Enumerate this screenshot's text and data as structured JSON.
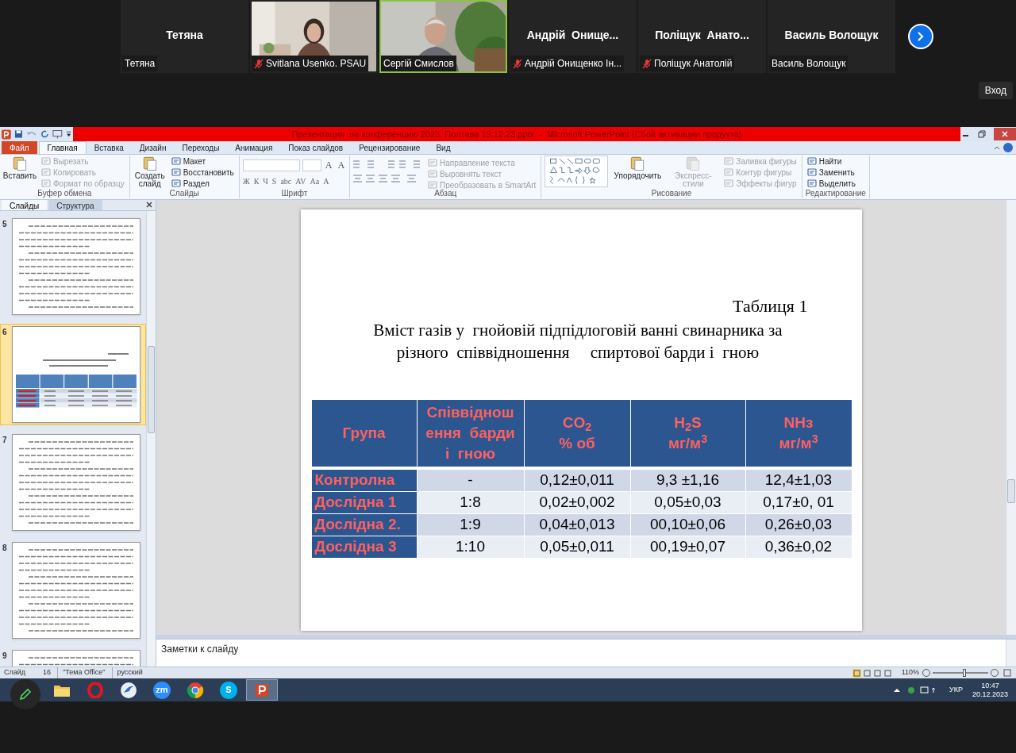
{
  "participants": [
    {
      "kind": "name",
      "display": "Тетяна",
      "label": "Тетяна",
      "muted": false,
      "selected": false
    },
    {
      "kind": "video",
      "label": "Svitlana Usenko. PSAU",
      "muted": true,
      "selected": false
    },
    {
      "kind": "video",
      "label": "Сергій Смислов",
      "muted": false,
      "selected": true
    },
    {
      "kind": "name",
      "display": "Андрій  Онище...",
      "label": "Андрій Онищенко Ін...",
      "muted": true,
      "selected": false
    },
    {
      "kind": "name",
      "display": "Поліщук  Анато...",
      "label": "Поліщук Анатолій",
      "muted": true,
      "selected": false
    },
    {
      "kind": "name",
      "display": "Василь Волощук",
      "label": "Василь Волощук",
      "muted": false,
      "selected": false
    }
  ],
  "sign_in_button": "Вход",
  "window": {
    "title": "Презентация  на конференцию 2023. Полтава 19.12.23.pptx  -  Microsoft PowerPoint (Сбой активации продукта)"
  },
  "tabs": [
    {
      "label": "Файл",
      "kind": "file",
      "selected": false
    },
    {
      "label": "Главная",
      "kind": "tab",
      "selected": true
    },
    {
      "label": "Вставка",
      "kind": "tab",
      "selected": false
    },
    {
      "label": "Дизайн",
      "kind": "tab",
      "selected": false
    },
    {
      "label": "Переходы",
      "kind": "tab",
      "selected": false
    },
    {
      "label": "Анимация",
      "kind": "tab",
      "selected": false
    },
    {
      "label": "Показ слайдов",
      "kind": "tab",
      "selected": false
    },
    {
      "label": "Рецензирование",
      "kind": "tab",
      "selected": false
    },
    {
      "label": "Вид",
      "kind": "tab",
      "selected": false
    }
  ],
  "ribbon_groups": [
    {
      "label": "Буфер обмена",
      "kind": "clipboard",
      "items": [
        {
          "label": "Вставить",
          "kind": "large",
          "disabled": false
        },
        {
          "label": "Вырезать",
          "kind": "small",
          "disabled": true
        },
        {
          "label": "Копировать",
          "kind": "small",
          "disabled": true
        },
        {
          "label": "Формат по образцу",
          "kind": "small",
          "disabled": true
        }
      ]
    },
    {
      "label": "Слайды",
      "kind": "slides",
      "items": [
        {
          "label": "Создать слайд",
          "kind": "large",
          "disabled": false
        },
        {
          "label": "Макет",
          "kind": "small",
          "disabled": false
        },
        {
          "label": "Восстановить",
          "kind": "small",
          "disabled": false
        },
        {
          "label": "Раздел",
          "kind": "small",
          "disabled": false
        }
      ]
    },
    {
      "label": "Шрифт",
      "kind": "font",
      "top_glyphs": [
        "A",
        "A"
      ],
      "bottom_glyphs": [
        "Ж",
        "К",
        "Ч",
        "S",
        "abc",
        "AV",
        "Aa",
        "A"
      ]
    },
    {
      "label": "Абзац",
      "kind": "paragraph",
      "items": [
        {
          "label": "Направление текста",
          "kind": "small",
          "disabled": true
        },
        {
          "label": "Выровнять текст",
          "kind": "small",
          "disabled": true
        },
        {
          "label": "Преобразовать в SmartArt",
          "kind": "small",
          "disabled": true
        }
      ]
    },
    {
      "label": "Рисование",
      "kind": "drawing",
      "items": [
        {
          "label": "Упорядочить",
          "kind": "large",
          "disabled": false
        },
        {
          "label": "Экспресс-стили",
          "kind": "large",
          "disabled": true
        },
        {
          "label": "Заливка фигуры",
          "kind": "small",
          "disabled": true
        },
        {
          "label": "Контур фигуры",
          "kind": "small",
          "disabled": true
        },
        {
          "label": "Эффекты фигур",
          "kind": "small",
          "disabled": true
        }
      ]
    },
    {
      "label": "Редактирование",
      "kind": "editing",
      "items": [
        {
          "label": "Найти",
          "kind": "small",
          "disabled": false
        },
        {
          "label": "Заменить",
          "kind": "small",
          "disabled": false
        },
        {
          "label": "Выделить",
          "kind": "small",
          "disabled": false
        }
      ]
    }
  ],
  "panel_tabs": [
    {
      "label": "Слайды",
      "selected": true
    },
    {
      "label": "Структура",
      "selected": false
    }
  ],
  "thumbnails": [
    {
      "number": "5",
      "kind": "text",
      "selected": false
    },
    {
      "number": "6",
      "kind": "table",
      "selected": true
    },
    {
      "number": "7",
      "kind": "text",
      "selected": false
    },
    {
      "number": "8",
      "kind": "text",
      "selected": false
    },
    {
      "number": "9",
      "kind": "text",
      "selected": false
    }
  ],
  "slide": {
    "caption": "Таблиця 1",
    "title_lines": [
      "Вміст газів у  гнойовій підпідлоговій ванні свинарника за",
      "різного  співвідношення     спиртової барди і  гною"
    ],
    "table": {
      "columns": [
        {
          "lines": [
            "Група"
          ]
        },
        {
          "lines": [
            "Співвіднош",
            "ення  барди",
            "і  гною"
          ]
        },
        {
          "lines": [
            "CO$_{2}$",
            "% об"
          ]
        },
        {
          "lines": [
            "H$_{2}$S",
            "мг/м$^{3}$"
          ]
        },
        {
          "lines": [
            "NHз",
            "мг/м$^{3}$"
          ]
        }
      ],
      "rows": [
        [
          "Контролна",
          "-",
          "0,12±0,011",
          "9,3 ±1,16",
          "12,4±1,03"
        ],
        [
          "Дослідна 1",
          "1:8",
          "0,02±0,002",
          "0,05±0,03",
          "0,17±0, 01"
        ],
        [
          "Дослідна 2.",
          "1:9",
          "0,04±0,013",
          "00,10±0,06",
          "0,26±0,03"
        ],
        [
          "Дослідна 3",
          "1:10",
          "0,05±0,011",
          "00,19±0,07",
          "0,36±0,02"
        ]
      ]
    }
  },
  "notes_placeholder": "Заметки к слайду",
  "status_bar": {
    "slide_label": "Слайд",
    "slide_total": "16",
    "theme": "\"Тема Office\"",
    "language": "русский",
    "zoom": {
      "reading": "110%",
      "level": 0.57
    }
  },
  "taskbar": {
    "apps": [
      {
        "kind": "explorer",
        "active": false
      },
      {
        "kind": "opera",
        "active": false
      },
      {
        "kind": "bird",
        "active": false
      },
      {
        "kind": "zoom",
        "label": "zm",
        "active": false
      },
      {
        "kind": "chrome",
        "active": false
      },
      {
        "kind": "skype",
        "label": "S",
        "active": false
      },
      {
        "kind": "powerpoint",
        "active": true
      }
    ],
    "language": "УКР",
    "time": "10:47",
    "date": "20.12.2023"
  }
}
